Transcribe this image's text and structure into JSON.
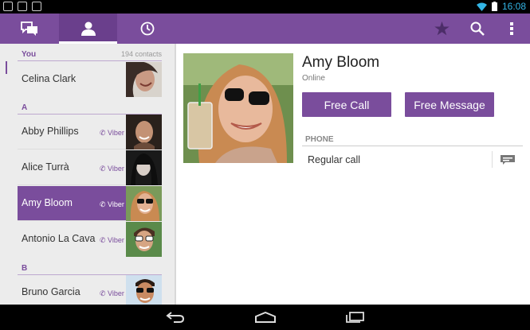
{
  "status_bar": {
    "time": "16:08"
  },
  "action_bar": {
    "tabs": [
      {
        "icon": "chat-bubbles-icon"
      },
      {
        "icon": "person-icon"
      },
      {
        "icon": "clock-icon"
      }
    ],
    "actions": [
      {
        "icon": "star-icon"
      },
      {
        "icon": "search-icon"
      },
      {
        "icon": "overflow-menu-icon"
      }
    ]
  },
  "contacts": {
    "you_header": "You",
    "count": "194 contacts",
    "me": {
      "name": "Celina Clark"
    },
    "section_a": "A",
    "section_b": "B",
    "viber_label": "Viber",
    "items": [
      {
        "name": "Abby Phillips"
      },
      {
        "name": "Alice Turrà"
      },
      {
        "name": "Amy Bloom"
      },
      {
        "name": "Antonio La Cava"
      },
      {
        "name": "Bruno Garcia"
      }
    ]
  },
  "detail": {
    "name": "Amy Bloom",
    "status": "Online",
    "free_call": "Free Call",
    "free_message": "Free Message",
    "phone_header": "PHONE",
    "regular_call": "Regular call"
  },
  "colors": {
    "accent": "#7a4d9c",
    "accent_dark": "#6a3f8c",
    "status_blue": "#33b5e5"
  }
}
